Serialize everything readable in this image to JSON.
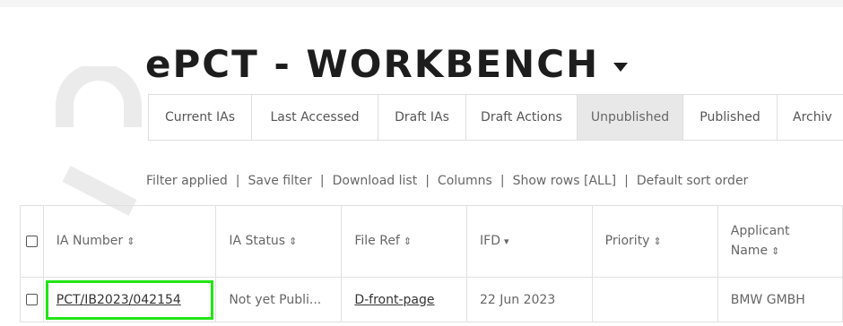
{
  "app": {
    "title": "ePCT - WORKBENCH"
  },
  "tabs": [
    {
      "label": "Current IAs",
      "active": false
    },
    {
      "label": "Last Accessed",
      "active": false
    },
    {
      "label": "Draft IAs",
      "active": false
    },
    {
      "label": "Draft Actions",
      "active": false
    },
    {
      "label": "Unpublished",
      "active": true
    },
    {
      "label": "Published",
      "active": false
    },
    {
      "label": "Archiv",
      "active": false
    }
  ],
  "toolbar": {
    "filter_applied": "Filter applied",
    "save_filter": "Save filter",
    "download_list": "Download list",
    "columns": "Columns",
    "show_rows": "Show rows [ALL]",
    "default_sort": "Default sort order",
    "separator": "|"
  },
  "table": {
    "headers": {
      "ia_number": "IA Number",
      "ia_status": "IA Status",
      "file_ref": "File Ref",
      "ifd": "IFD",
      "priority": "Priority",
      "applicant_line1": "Applicant",
      "applicant_line2": "Name"
    },
    "sort_icons": {
      "ia_number": "sort-both-icon",
      "ia_status": "sort-both-icon",
      "file_ref": "sort-both-icon",
      "ifd": "sort-desc-icon",
      "priority": "sort-both-icon",
      "applicant": "sort-both-icon"
    },
    "rows": [
      {
        "ia_number": "PCT/IB2023/042154",
        "ia_status": "Not yet Publi...",
        "file_ref": "D-front-page",
        "ifd": "22 Jun 2023",
        "priority": "",
        "applicant": "BMW GMBH"
      }
    ]
  },
  "colors": {
    "highlight": "#22e515",
    "active_tab_bg": "#e8e8e8",
    "watermark": "#ebebeb"
  }
}
